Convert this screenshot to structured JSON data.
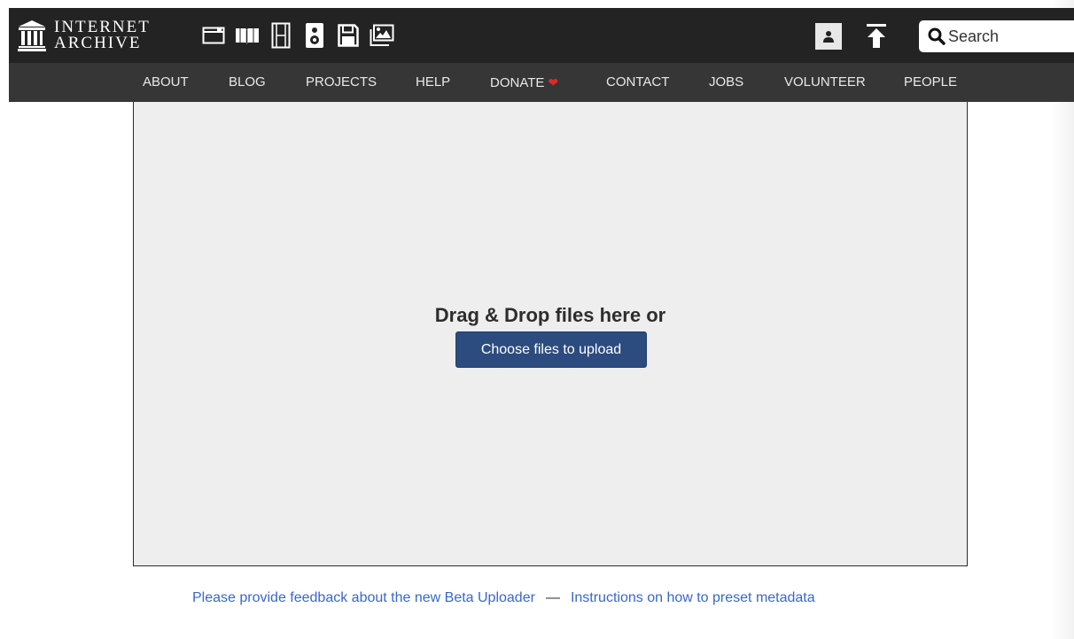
{
  "header": {
    "logo_line1": "INTERNET",
    "logo_line2": "ARCHIVE",
    "media_icons": [
      "web-icon",
      "texts-icon",
      "video-icon",
      "audio-icon",
      "software-icon",
      "images-icon"
    ],
    "user_icon": "user-icon",
    "upload_icon": "upload-icon",
    "search": {
      "placeholder": "Search",
      "value": ""
    }
  },
  "subnav": {
    "items": [
      "ABOUT",
      "BLOG",
      "PROJECTS",
      "HELP",
      "DONATE",
      "CONTACT",
      "JOBS",
      "VOLUNTEER",
      "PEOPLE"
    ],
    "donate_icon": "heart-icon"
  },
  "dropzone": {
    "title": "Drag & Drop files here or",
    "button_label": "Choose files to upload"
  },
  "footer": {
    "feedback_link": "Please provide feedback about the new Beta Uploader",
    "separator": "—",
    "instructions_link": "Instructions on how to preset metadata"
  },
  "colors": {
    "topbar": "#232323",
    "subnav": "#363636",
    "button": "#2c4b7e",
    "link": "#3a67c9",
    "heart": "#e3262b"
  }
}
